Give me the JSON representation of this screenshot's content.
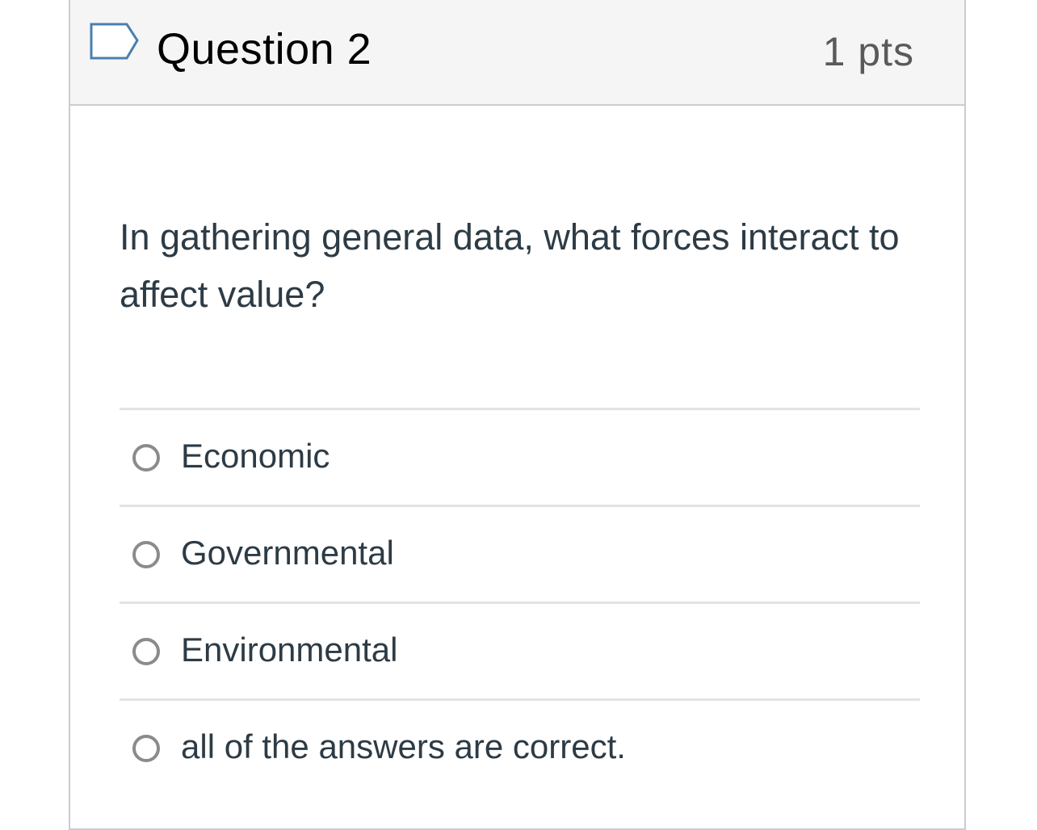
{
  "question": {
    "title": "Question 2",
    "points": "1 pts",
    "flag_icon": "flag-outline-icon",
    "text": "In gathering general data, what forces interact to affect value?"
  },
  "answers": [
    {
      "label": "Economic",
      "selected": false
    },
    {
      "label": "Governmental",
      "selected": false
    },
    {
      "label": "Environmental",
      "selected": false
    },
    {
      "label": "all of the answers are correct.",
      "selected": false
    }
  ],
  "colors": {
    "header_background": "#f5f5f5",
    "border": "#c7cdd1",
    "flag_outline": "#4a7fb0",
    "radio_border": "#8b8b8b",
    "divider": "#e1e4e6"
  }
}
